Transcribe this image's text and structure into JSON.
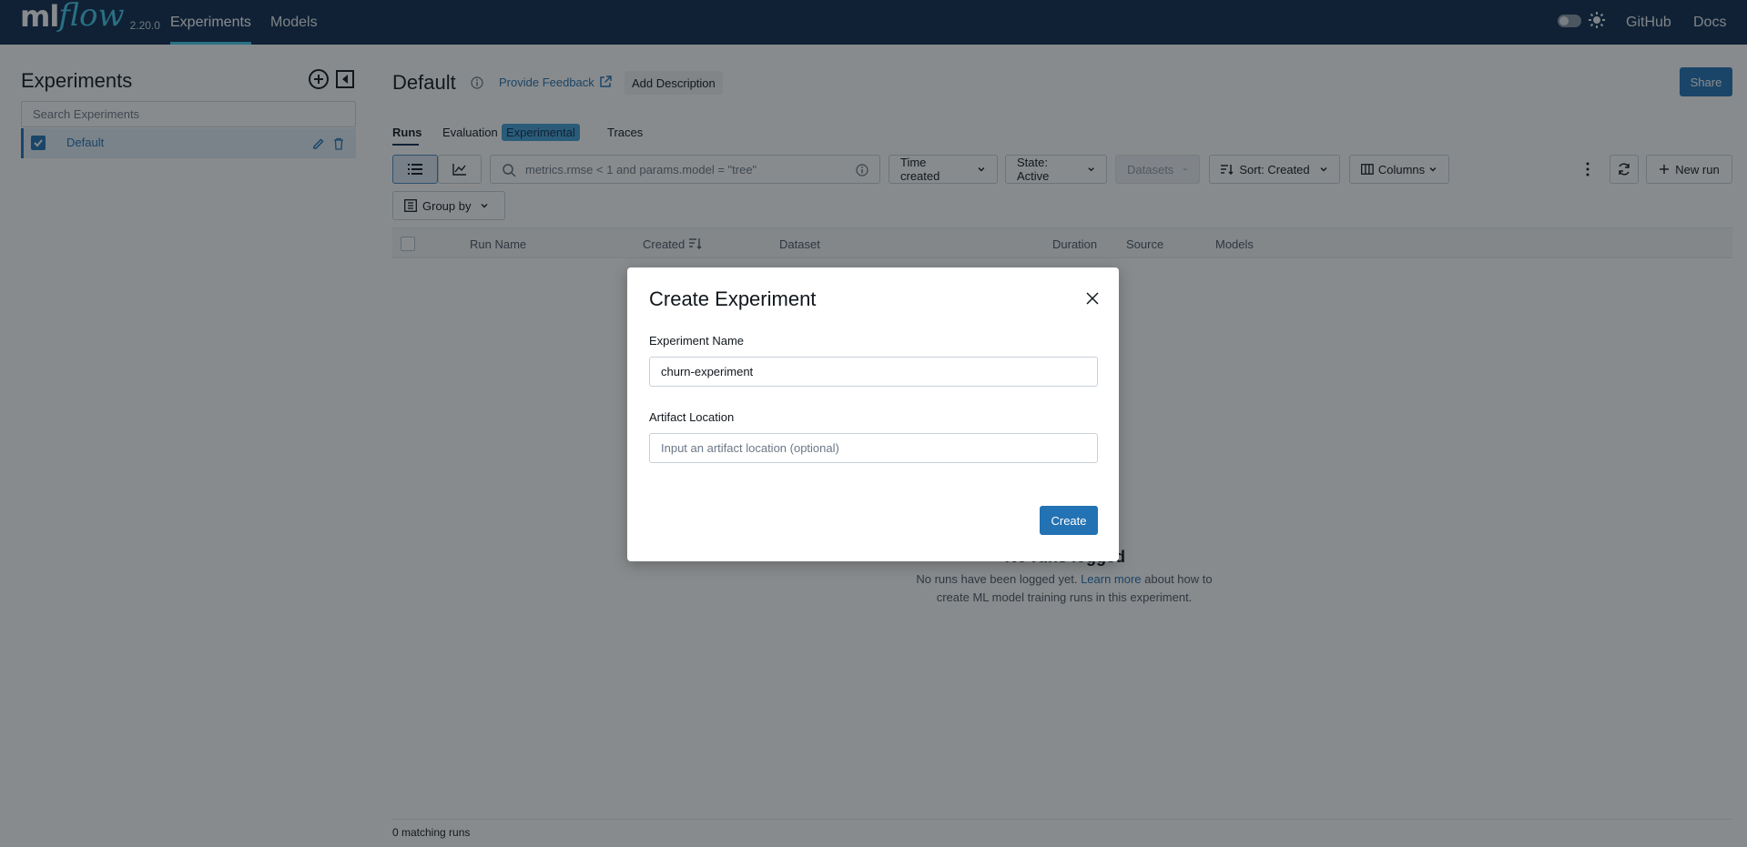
{
  "brand": {
    "logo_ml": "ml",
    "logo_flow": "flow",
    "version": "2.20.0"
  },
  "nav": {
    "experiments": "Experiments",
    "models": "Models",
    "github": "GitHub",
    "docs": "Docs"
  },
  "sidebar": {
    "title": "Experiments",
    "search_placeholder": "Search Experiments",
    "items": [
      {
        "label": "Default",
        "selected": true
      }
    ]
  },
  "main": {
    "title": "Default",
    "feedback_label": "Provide Feedback",
    "add_description_label": "Add Description",
    "share_label": "Share",
    "tabs": {
      "runs": "Runs",
      "evaluation": "Evaluation",
      "experimental_badge": "Experimental",
      "traces": "Traces"
    },
    "toolbar": {
      "search_placeholder": "metrics.rmse < 1 and params.model = \"tree\"",
      "time_created": "Time created",
      "state": "State: Active",
      "datasets": "Datasets",
      "sort": "Sort: Created",
      "columns": "Columns",
      "new_run": "New run",
      "group_by": "Group by"
    },
    "table": {
      "columns": [
        "Run Name",
        "Created",
        "Dataset",
        "Duration",
        "Source",
        "Models"
      ]
    },
    "empty": {
      "title": "No runs logged",
      "text_before": "No runs have been logged yet. ",
      "link": "Learn more",
      "text_after": " about how to create ML model training runs in this experiment."
    },
    "footer_count": "0 matching runs"
  },
  "modal": {
    "title": "Create Experiment",
    "name_label": "Experiment Name",
    "name_value": "churn-experiment",
    "artifact_label": "Artifact Location",
    "artifact_placeholder": "Input an artifact location (optional)",
    "create_label": "Create"
  },
  "colors": {
    "nav_bg": "#0e2a4f",
    "accent": "#2272b4",
    "logo_flow": "#43c9ed"
  }
}
